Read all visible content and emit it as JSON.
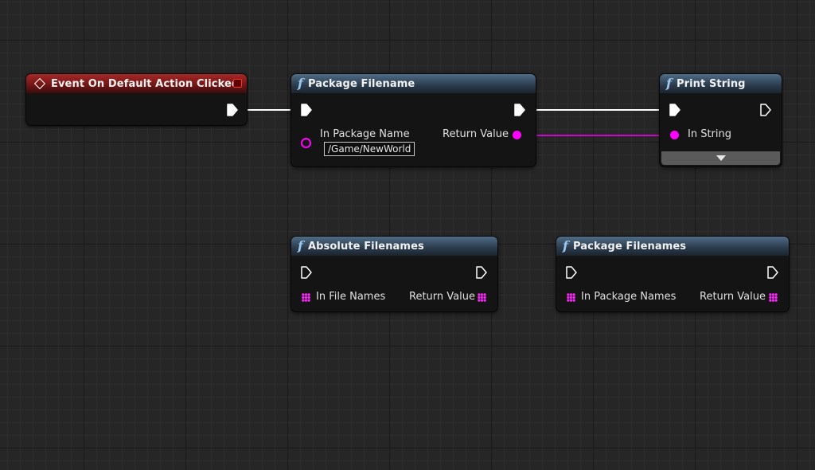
{
  "colors": {
    "event_header": "#a72727",
    "function_header": "#4f6c87",
    "string_pin": "#ff00ff",
    "exec_wire": "#ffffff",
    "grid_background": "#262626"
  },
  "nodes": {
    "event_on_default_action_clicked": {
      "title": "Event On Default Action Clicked",
      "icon": "event-diamond-icon"
    },
    "package_filename": {
      "title": "Package Filename",
      "icon": "function-icon",
      "input_label": "In Package Name",
      "input_value": "/Game/NewWorld",
      "output_label": "Return Value"
    },
    "print_string": {
      "title": "Print String",
      "icon": "function-icon",
      "input_label": "In String",
      "advanced_icon": "expand-arrow-icon"
    },
    "absolute_filenames": {
      "title": "Absolute Filenames",
      "icon": "function-icon",
      "input_label": "In File Names",
      "output_label": "Return Value"
    },
    "package_filenames": {
      "title": "Package Filenames",
      "icon": "function-icon",
      "input_label": "In Package Names",
      "output_label": "Return Value"
    }
  }
}
